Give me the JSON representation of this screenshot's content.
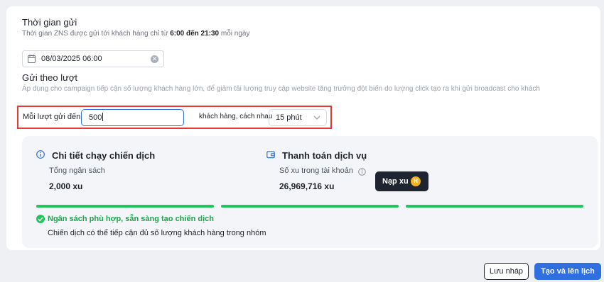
{
  "send_time": {
    "title": "Thời gian gửi",
    "note_prefix": "Thời gian ZNS được gửi tới khách hàng chỉ từ",
    "note_from": "6:00",
    "note_mid": "đến",
    "note_to": "21:30",
    "note_suffix": "mỗi ngày",
    "datetime_value": "08/03/2025 06:00"
  },
  "batch": {
    "title": "Gửi theo lượt",
    "note": "Áp dụng cho campaign tiếp cận số lượng khách hàng lớn, để giảm tải lượng truy cập website tăng trưởng đột biến do lượng click tạo ra khi gửi broadcast cho khách",
    "per_batch_label": "Mỗi lượt gửi đến",
    "per_batch_value": "500",
    "interval_label": "khách hàng, cách nhau",
    "interval_value": "15 phút"
  },
  "summary": {
    "campaign_title": "Chi tiết chạy chiến dịch",
    "budget_label": "Tổng ngân sách",
    "budget_value": "2,000 xu",
    "payment_title": "Thanh toán dịch vụ",
    "balance_label": "Số xu trong tài khoản",
    "balance_value": "26,969,716 xu",
    "topup_label": "Nạp xu",
    "coin_symbol": "H",
    "status_ok": "Ngân sách phù hợp, sẵn sàng tạo chiến dịch",
    "status_desc": "Chiến dịch có thể tiếp cận đủ số lượng khách hàng trong nhóm",
    "accent_color": "#22c55e"
  },
  "actions": {
    "draft_label": "Lưu nháp",
    "create_label": "Tạo và lên lịch"
  }
}
